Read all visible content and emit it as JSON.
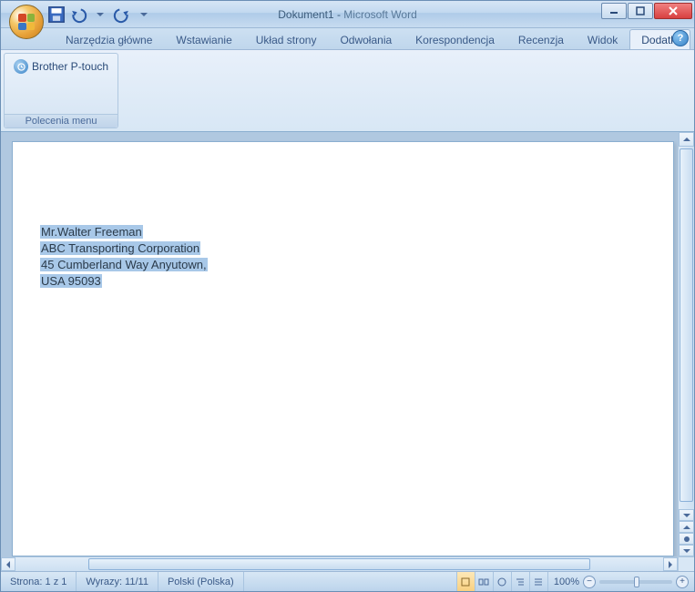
{
  "title": {
    "doc": "Dokument1",
    "sep": " - ",
    "app": "Microsoft Word"
  },
  "qat": {
    "save": "save-icon",
    "undo": "undo-icon",
    "redo": "redo-icon"
  },
  "tabs": [
    {
      "label": "Narzędzia główne"
    },
    {
      "label": "Wstawianie"
    },
    {
      "label": "Układ strony"
    },
    {
      "label": "Odwołania"
    },
    {
      "label": "Korespondencja"
    },
    {
      "label": "Recenzja"
    },
    {
      "label": "Widok"
    },
    {
      "label": "Dodatki",
      "active": true
    }
  ],
  "ribbon": {
    "group_label": "Polecenia menu",
    "btn_label": "Brother P-touch"
  },
  "document": {
    "lines": [
      "Mr.Walter Freeman",
      "ABC Transporting Corporation",
      "45 Cumberland Way Anyutown,",
      "USA 95093"
    ]
  },
  "status": {
    "page": "Strona: 1 z 1",
    "words": "Wyrazy: 11/11",
    "lang": "Polski (Polska)",
    "zoom_pct": "100%"
  }
}
